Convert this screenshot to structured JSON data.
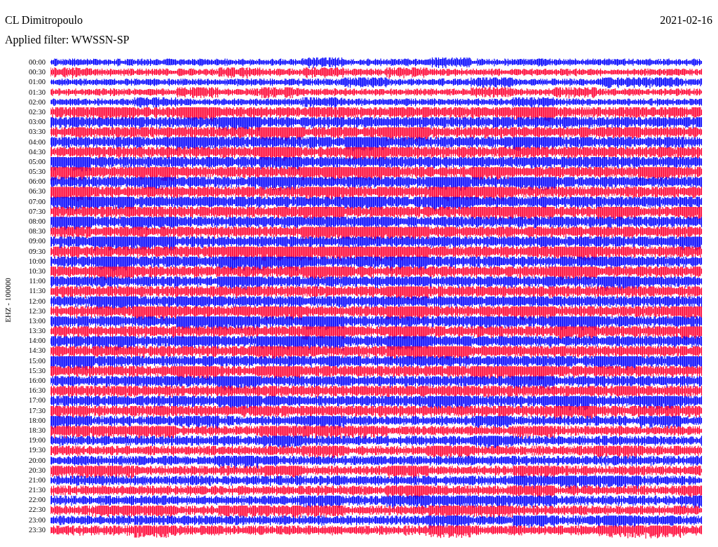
{
  "header": {
    "station": "CL Dimitropoulo",
    "filter": "Applied filter: WWSSN-SP",
    "date": "2021-02-16"
  },
  "plot": {
    "channel_label": "EHZ - 100000",
    "rows": [
      {
        "time": "00:00",
        "color": "#0000ff"
      },
      {
        "time": "00:30",
        "color": "#ff0033"
      },
      {
        "time": "01:00",
        "color": "#0000ff"
      },
      {
        "time": "01:30",
        "color": "#ff0033"
      },
      {
        "time": "02:00",
        "color": "#0000ff"
      },
      {
        "time": "02:30",
        "color": "#ff0033"
      },
      {
        "time": "03:00",
        "color": "#0000ff"
      },
      {
        "time": "03:30",
        "color": "#ff0033"
      },
      {
        "time": "04:00",
        "color": "#0000ff"
      },
      {
        "time": "04:30",
        "color": "#ff0033"
      },
      {
        "time": "05:00",
        "color": "#0000ff"
      },
      {
        "time": "05:30",
        "color": "#ff0033"
      },
      {
        "time": "06:00",
        "color": "#0000ff"
      },
      {
        "time": "06:30",
        "color": "#ff0033"
      },
      {
        "time": "07:00",
        "color": "#0000ff"
      },
      {
        "time": "07:30",
        "color": "#ff0033"
      },
      {
        "time": "08:00",
        "color": "#0000ff"
      },
      {
        "time": "08:30",
        "color": "#ff0033"
      },
      {
        "time": "09:00",
        "color": "#0000ff"
      },
      {
        "time": "09:30",
        "color": "#ff0033"
      },
      {
        "time": "10:00",
        "color": "#0000ff"
      },
      {
        "time": "10:30",
        "color": "#ff0033"
      },
      {
        "time": "11:00",
        "color": "#0000ff"
      },
      {
        "time": "11:30",
        "color": "#ff0033"
      },
      {
        "time": "12:00",
        "color": "#0000ff"
      },
      {
        "time": "12:30",
        "color": "#ff0033"
      },
      {
        "time": "13:00",
        "color": "#0000ff"
      },
      {
        "time": "13:30",
        "color": "#ff0033"
      },
      {
        "time": "14:00",
        "color": "#0000ff"
      },
      {
        "time": "14:30",
        "color": "#ff0033"
      },
      {
        "time": "15:00",
        "color": "#0000ff"
      },
      {
        "time": "15:30",
        "color": "#ff0033"
      },
      {
        "time": "16:00",
        "color": "#0000ff"
      },
      {
        "time": "16:30",
        "color": "#ff0033"
      },
      {
        "time": "17:00",
        "color": "#0000ff"
      },
      {
        "time": "17:30",
        "color": "#ff0033"
      },
      {
        "time": "18:00",
        "color": "#0000ff"
      },
      {
        "time": "18:30",
        "color": "#ff0033"
      },
      {
        "time": "19:00",
        "color": "#0000ff"
      },
      {
        "time": "19:30",
        "color": "#ff0033"
      },
      {
        "time": "20:00",
        "color": "#0000ff"
      },
      {
        "time": "20:30",
        "color": "#ff0033"
      },
      {
        "time": "21:00",
        "color": "#0000ff"
      },
      {
        "time": "21:30",
        "color": "#ff0033"
      },
      {
        "time": "22:00",
        "color": "#0000ff"
      },
      {
        "time": "22:30",
        "color": "#ff0033"
      },
      {
        "time": "23:00",
        "color": "#0000ff"
      },
      {
        "time": "23:30",
        "color": "#ff0033"
      }
    ]
  }
}
